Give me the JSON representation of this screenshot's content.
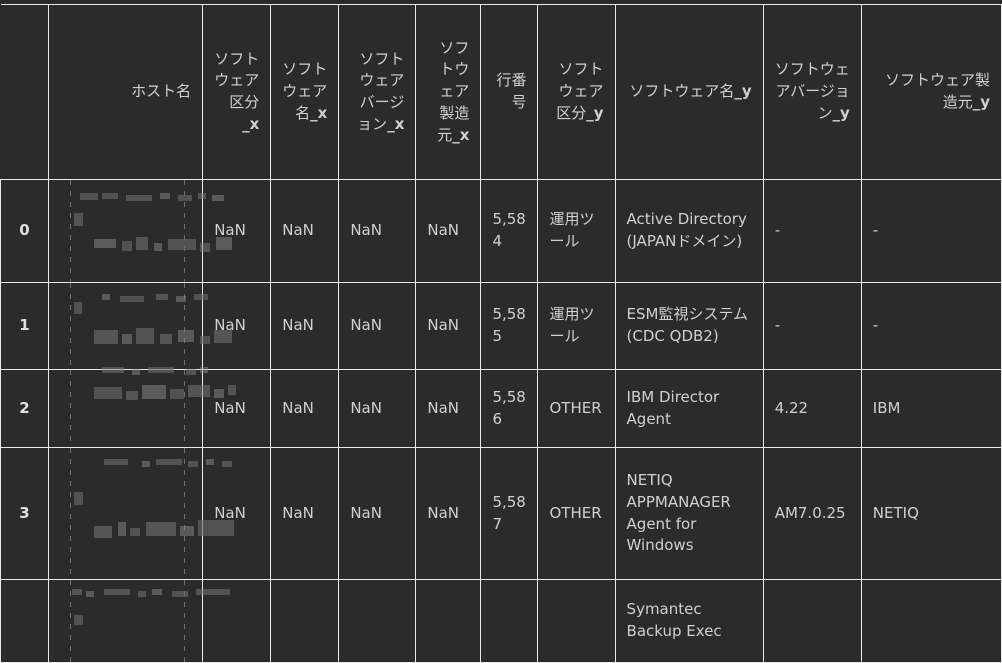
{
  "table": {
    "index_header": "",
    "columns": [
      {
        "id": "hostname",
        "label": "ホスト名",
        "suffix": ""
      },
      {
        "id": "sw_kubun_x",
        "label": "ソフトウェア区分",
        "suffix": "_x"
      },
      {
        "id": "sw_name_x",
        "label": "ソフトウェア名",
        "suffix": "_x"
      },
      {
        "id": "sw_version_x",
        "label": "ソフトウェアバージョン",
        "suffix": "_x"
      },
      {
        "id": "sw_vendor_x",
        "label": "ソフトウェア製造元",
        "suffix": "_x"
      },
      {
        "id": "row_no",
        "label": "行番号",
        "suffix": ""
      },
      {
        "id": "sw_kubun_y",
        "label": "ソフトウェア区分",
        "suffix": "_y"
      },
      {
        "id": "sw_name_y",
        "label": "ソフトウェア名",
        "suffix": "_y"
      },
      {
        "id": "sw_version_y",
        "label": "ソフトウェアバージョン",
        "suffix": "_y"
      },
      {
        "id": "sw_vendor_y",
        "label": "ソフトウェア製造元",
        "suffix": "_y"
      }
    ],
    "rows": [
      {
        "index": "0",
        "hostname": "",
        "hostname_redacted": true,
        "sw_kubun_x": "NaN",
        "sw_name_x": "NaN",
        "sw_version_x": "NaN",
        "sw_vendor_x": "NaN",
        "row_no": "5,584",
        "sw_kubun_y": "運用ツール",
        "sw_name_y": "Active Directory (JAPANドメイン)",
        "sw_version_y": "-",
        "sw_vendor_y": "-"
      },
      {
        "index": "1",
        "hostname": "",
        "hostname_redacted": true,
        "sw_kubun_x": "NaN",
        "sw_name_x": "NaN",
        "sw_version_x": "NaN",
        "sw_vendor_x": "NaN",
        "row_no": "5,585",
        "sw_kubun_y": "運用ツール",
        "sw_name_y": "ESM監視システム (CDC QDB2)",
        "sw_version_y": "-",
        "sw_vendor_y": "-"
      },
      {
        "index": "2",
        "hostname": "",
        "hostname_redacted": true,
        "sw_kubun_x": "NaN",
        "sw_name_x": "NaN",
        "sw_version_x": "NaN",
        "sw_vendor_x": "NaN",
        "row_no": "5,586",
        "sw_kubun_y": "OTHER",
        "sw_name_y": "IBM Director Agent",
        "sw_version_y": "4.22",
        "sw_vendor_y": "IBM"
      },
      {
        "index": "3",
        "hostname": "",
        "hostname_redacted": true,
        "sw_kubun_x": "NaN",
        "sw_name_x": "NaN",
        "sw_version_x": "NaN",
        "sw_vendor_x": "NaN",
        "row_no": "5,587",
        "sw_kubun_y": "OTHER",
        "sw_name_y": "NETIQ APPMANAGER Agent for Windows",
        "sw_version_y": "AM7.0.25",
        "sw_vendor_y": "NETIQ"
      },
      {
        "index": "",
        "hostname": "",
        "hostname_redacted": true,
        "sw_kubun_x": "",
        "sw_name_x": "",
        "sw_version_x": "",
        "sw_vendor_x": "",
        "row_no": "",
        "sw_kubun_y": "",
        "sw_name_y": "Symantec Backup Exec",
        "sw_version_y": "",
        "sw_vendor_y": ""
      }
    ]
  },
  "theme": {
    "background": "#2b2b2b",
    "text": "#d0d0d0",
    "gridline": "#e8e8e8",
    "redaction": "#6a6a6a"
  }
}
